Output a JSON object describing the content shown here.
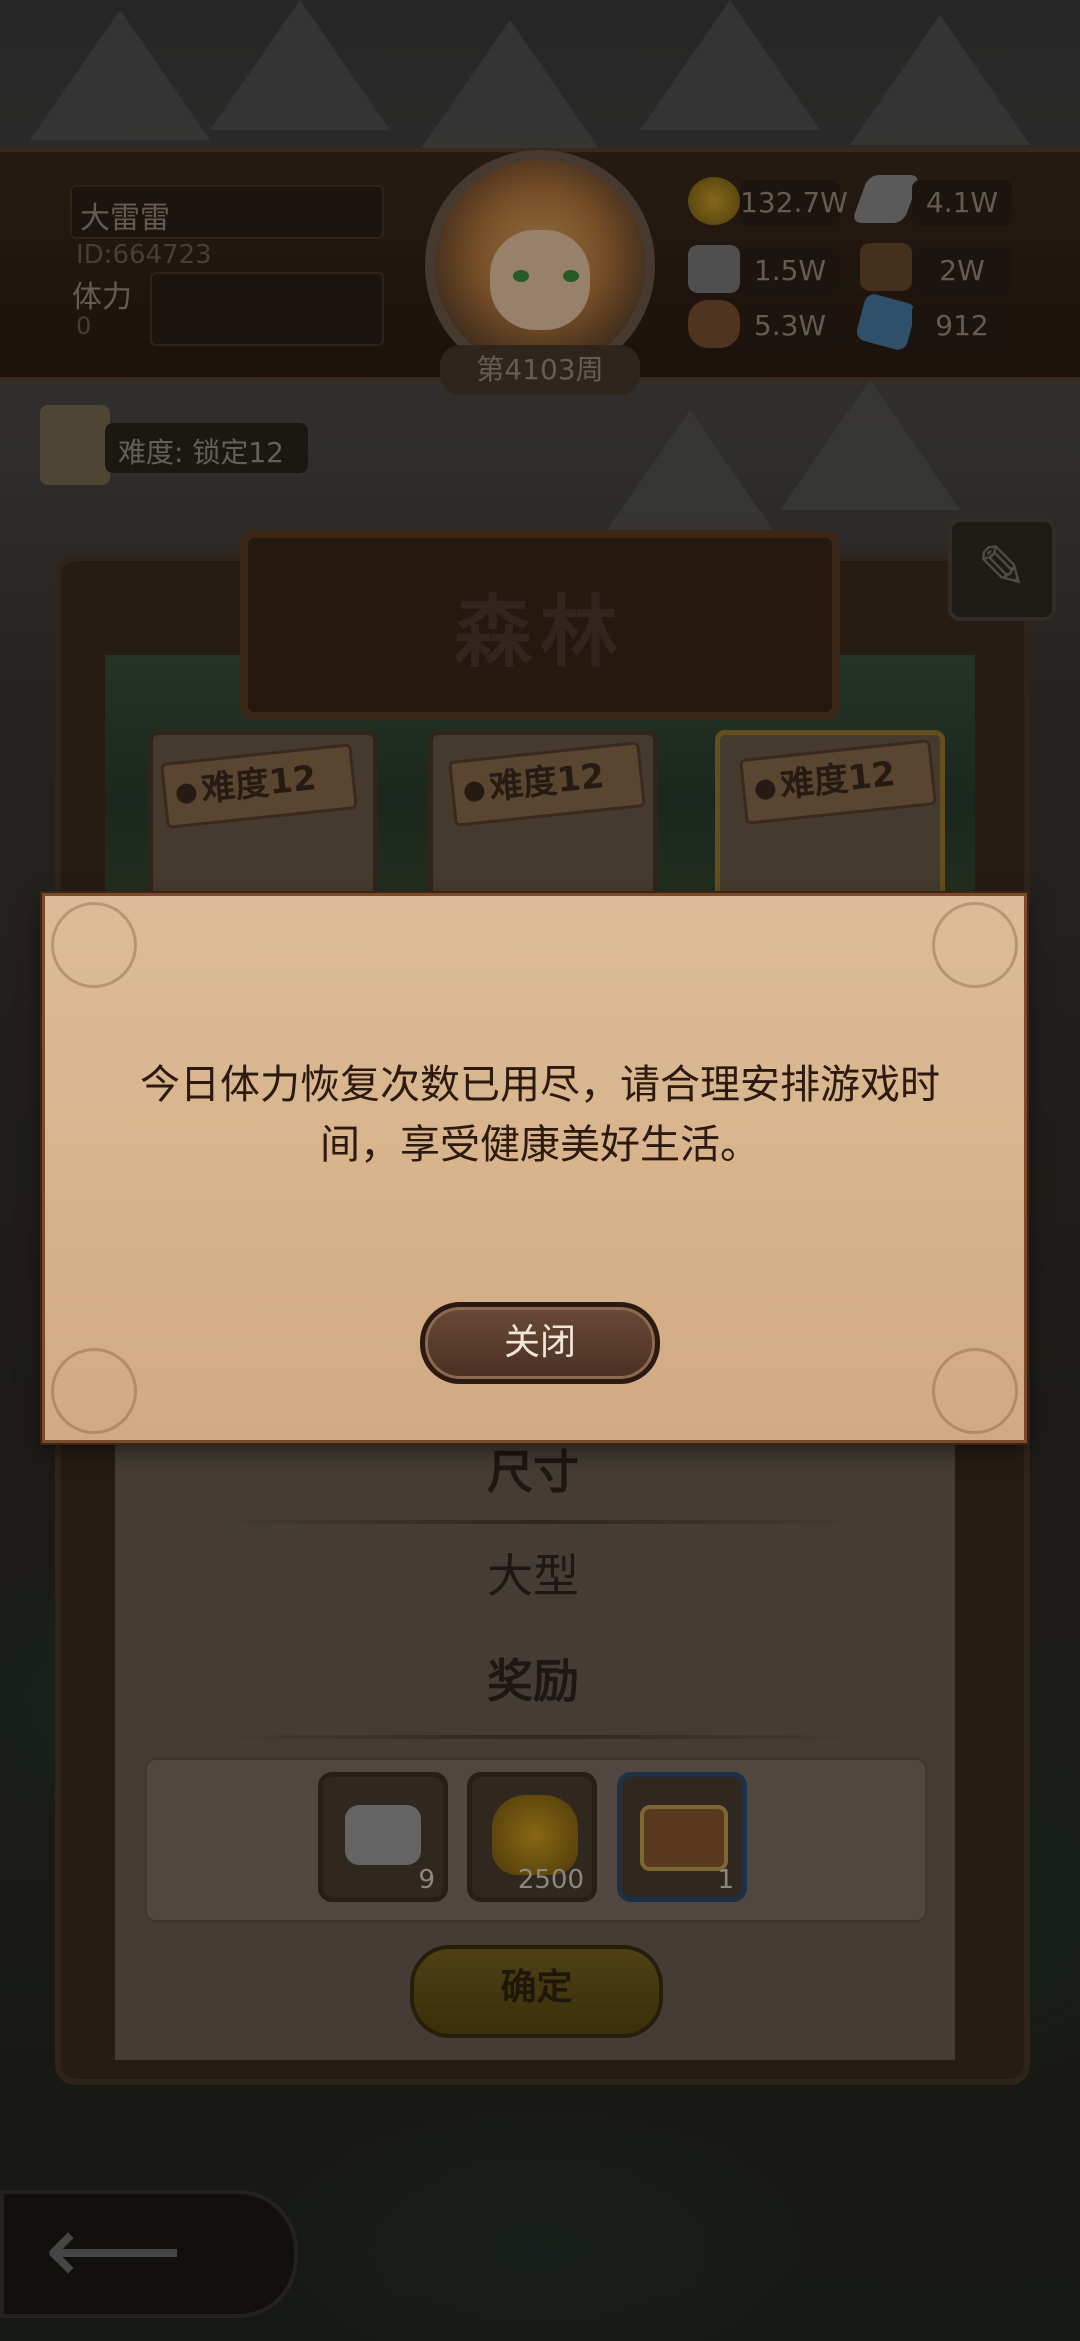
{
  "player": {
    "name": "大雷雷",
    "id": "ID:664723",
    "stamina_label": "体力",
    "stamina_value": "0",
    "week": "第4103周"
  },
  "resources": {
    "gold": "132.7W",
    "iron": "4.1W",
    "stone": "1.5W",
    "leather": "2W",
    "wood": "5.3W",
    "crystal": "912"
  },
  "difficulty_lock": "难度: 锁定12",
  "panel": {
    "title": "森林",
    "cards": [
      {
        "label": "难度12",
        "selected": false
      },
      {
        "label": "难度12",
        "selected": false
      },
      {
        "label": "难度12",
        "selected": true
      }
    ],
    "size_label": "尺寸",
    "size_value": "大型",
    "reward_label": "奖励",
    "rewards": [
      {
        "icon": "ore-icon",
        "count": "9"
      },
      {
        "icon": "gold-bag-icon",
        "count": "2500"
      },
      {
        "icon": "treasure-chest-icon",
        "count": "1"
      }
    ],
    "confirm_label": "确定"
  },
  "dialog": {
    "message_line1": "今日体力恢复次数已用尽，请合理安排游戏时",
    "message_line2": "间，享受健康美好生活。",
    "close_label": "关闭"
  },
  "colors": {
    "dialog_bg": "#d7b48c",
    "dialog_border": "#7a4a2c",
    "button_bg": "#4a3022"
  }
}
